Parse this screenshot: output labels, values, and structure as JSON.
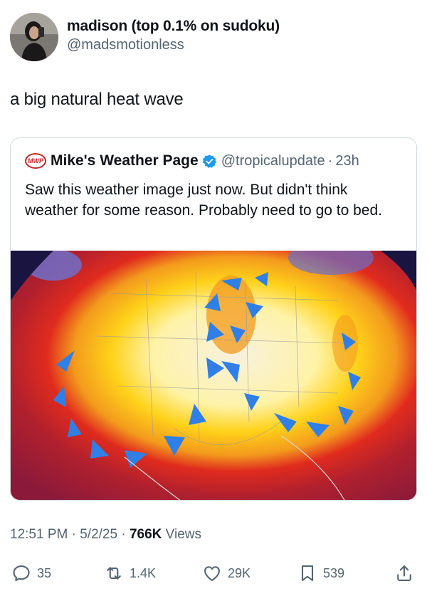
{
  "author": {
    "display_name": "madison (top 0.1% on sudoku)",
    "handle": "@madsmotionless"
  },
  "tweet": {
    "text": "a big natural heat wave"
  },
  "quoted": {
    "logo_text": "MWP",
    "name": "Mike's Weather Page",
    "handle": "@tropicalupdate",
    "separator": "·",
    "time": "23h",
    "text": "Saw this weather image just now. But didn't think weather for some reason. Probably need to go to bed."
  },
  "meta": {
    "time": "12:51 PM",
    "date": "5/2/25",
    "views_count": "766K",
    "views_label": "Views",
    "separator": "·"
  },
  "actions": {
    "replies": "35",
    "reposts": "1.4K",
    "likes": "29K",
    "bookmarks": "539"
  },
  "colors": {
    "text": "#0f1419",
    "secondary": "#536471",
    "verified": "#1d9bf0",
    "border": "#cfd9de",
    "heat_dark": "#8b1a3a",
    "heat_red": "#e02b1e",
    "heat_orange": "#f07a1c",
    "heat_yellow": "#ffd21a",
    "front_blue": "#2f7fe6"
  },
  "icons": [
    "reply-icon",
    "repost-icon",
    "like-icon",
    "bookmark-icon",
    "share-icon",
    "verified-icon"
  ]
}
